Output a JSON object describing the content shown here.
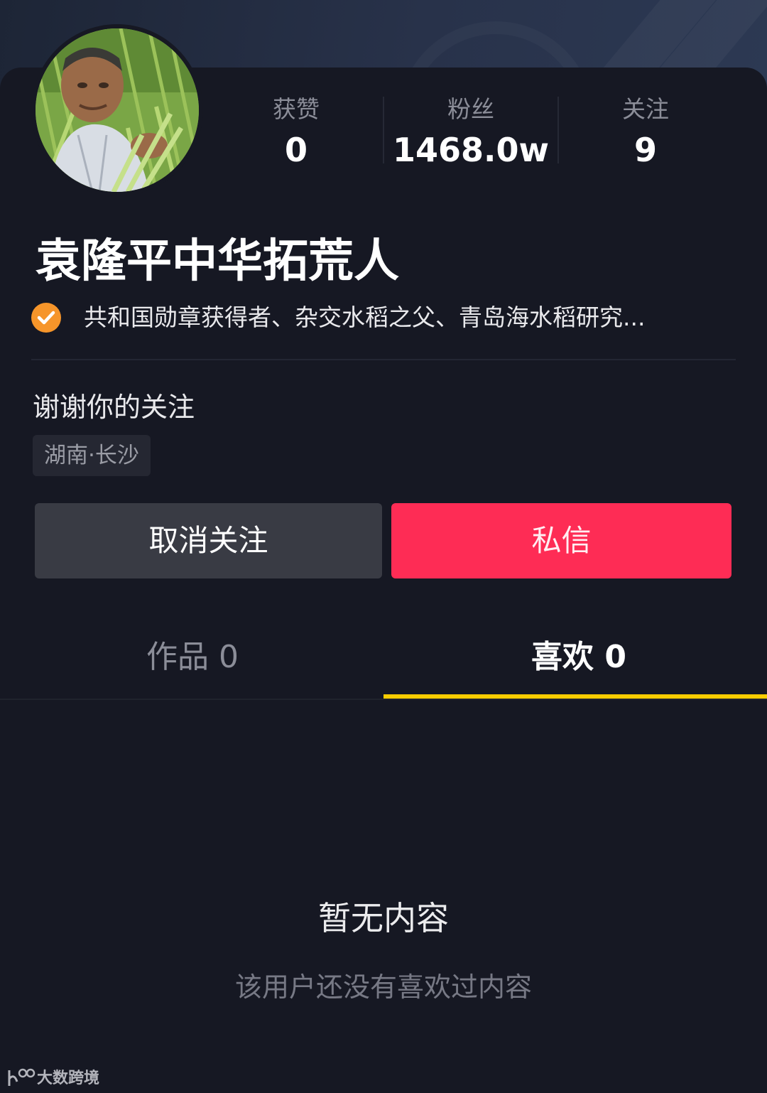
{
  "profile": {
    "name": "袁隆平中华拓荒人",
    "verification": "共和国勋章获得者、杂交水稻之父、青岛海水稻研究...",
    "bio": "谢谢你的关注",
    "location": "湖南·长沙",
    "avatar_icon": "avatar-photo"
  },
  "stats": [
    {
      "label": "获赞",
      "value": "0"
    },
    {
      "label": "粉丝",
      "value": "1468.0w"
    },
    {
      "label": "关注",
      "value": "9"
    }
  ],
  "actions": {
    "unfollow_label": "取消关注",
    "message_label": "私信"
  },
  "tabs": [
    {
      "label": "作品 0",
      "active": false
    },
    {
      "label": "喜欢 0",
      "active": true
    }
  ],
  "empty": {
    "title": "暂无内容",
    "subtitle": "该用户还没有喜欢过内容"
  },
  "watermark": {
    "text": "大数跨境"
  },
  "colors": {
    "background": "#161823",
    "accent_red": "#fe2c55",
    "tab_indicator": "#facd00",
    "verify_badge": "#f6952a"
  }
}
